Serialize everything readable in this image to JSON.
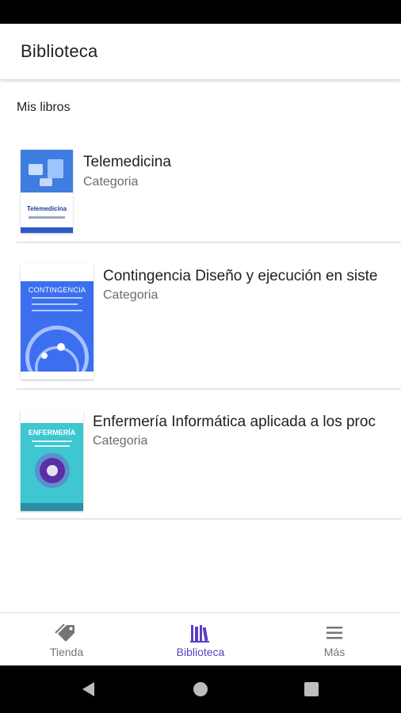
{
  "app_bar": {
    "title": "Biblioteca"
  },
  "section": {
    "title": "Mis libros"
  },
  "books": [
    {
      "title": "Telemedicina",
      "category": "Categoria",
      "cover_text": "Telemedicina"
    },
    {
      "title": "Contingencia Diseño y ejecución en siste",
      "category": "Categoria",
      "cover_text": "CONTINGENCIA"
    },
    {
      "title": "Enfermería Informática aplicada a los proc",
      "category": "Categoria",
      "cover_text": "ENFERMERÍA"
    }
  ],
  "bottom_nav": {
    "items": [
      {
        "label": "Tienda",
        "icon": "tag-icon",
        "active": false
      },
      {
        "label": "Biblioteca",
        "icon": "library-icon",
        "active": true
      },
      {
        "label": "Más",
        "icon": "menu-icon",
        "active": false
      }
    ]
  },
  "colors": {
    "accent": "#5a3fc4",
    "inactive": "#757575",
    "text": "#212121",
    "secondary_text": "#6b6b6b"
  },
  "system_nav": {
    "icons": [
      "back-icon",
      "home-icon",
      "recents-icon"
    ]
  }
}
